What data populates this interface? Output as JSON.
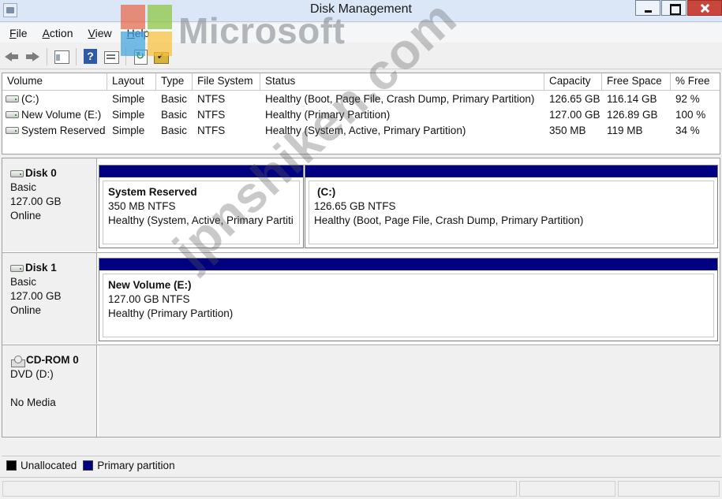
{
  "window": {
    "title": "Disk Management"
  },
  "menu": [
    {
      "underline": "F",
      "rest": "ile"
    },
    {
      "underline": "A",
      "rest": "ction"
    },
    {
      "underline": "V",
      "rest": "iew"
    },
    {
      "underline": "H",
      "rest": "elp"
    }
  ],
  "toolbar": {
    "icons": [
      "back-arrow-icon",
      "forward-arrow-icon",
      "console-tree-icon",
      "help-icon",
      "list-view-icon",
      "refresh-icon",
      "properties-icon"
    ]
  },
  "volume_table": {
    "columns": [
      "Volume",
      "Layout",
      "Type",
      "File System",
      "Status",
      "Capacity",
      "Free Space",
      "% Free"
    ],
    "rows": [
      [
        "(C:)",
        "Simple",
        "Basic",
        "NTFS",
        "Healthy (Boot, Page File, Crash Dump, Primary Partition)",
        "126.65 GB",
        "116.14 GB",
        "92 %"
      ],
      [
        "New Volume (E:)",
        "Simple",
        "Basic",
        "NTFS",
        "Healthy (Primary Partition)",
        "127.00 GB",
        "126.89 GB",
        "100 %"
      ],
      [
        "System Reserved",
        "Simple",
        "Basic",
        "NTFS",
        "Healthy (System, Active, Primary Partition)",
        "350 MB",
        "119 MB",
        "34 %"
      ]
    ]
  },
  "disks": [
    {
      "name": "Disk 0",
      "type": "Basic",
      "size": "127.00 GB",
      "state": "Online",
      "partitions": [
        {
          "name": "System Reserved",
          "size": "350 MB NTFS",
          "status": "Healthy (System, Active, Primary Partiti"
        },
        {
          "name": "(C:)",
          "size": "126.65 GB NTFS",
          "status": "Healthy (Boot, Page File, Crash Dump, Primary Partition)"
        }
      ]
    },
    {
      "name": "Disk 1",
      "type": "Basic",
      "size": "127.00 GB",
      "state": "Online",
      "partitions": [
        {
          "name": "New Volume  (E:)",
          "size": "127.00 GB NTFS",
          "status": "Healthy (Primary Partition)"
        }
      ]
    },
    {
      "name": "CD-ROM 0",
      "type": "DVD (D:)",
      "size": "",
      "state": "No Media",
      "partitions": []
    }
  ],
  "legend": [
    {
      "label": "Unallocated",
      "color": "#000000"
    },
    {
      "label": "Primary partition",
      "color": "#000080"
    }
  ],
  "colors": {
    "partition_bar": "#000080",
    "titlebar": "#dbe7f7"
  },
  "watermarks": {
    "brand": "Microsoft",
    "site": "jpnshiken.com"
  }
}
